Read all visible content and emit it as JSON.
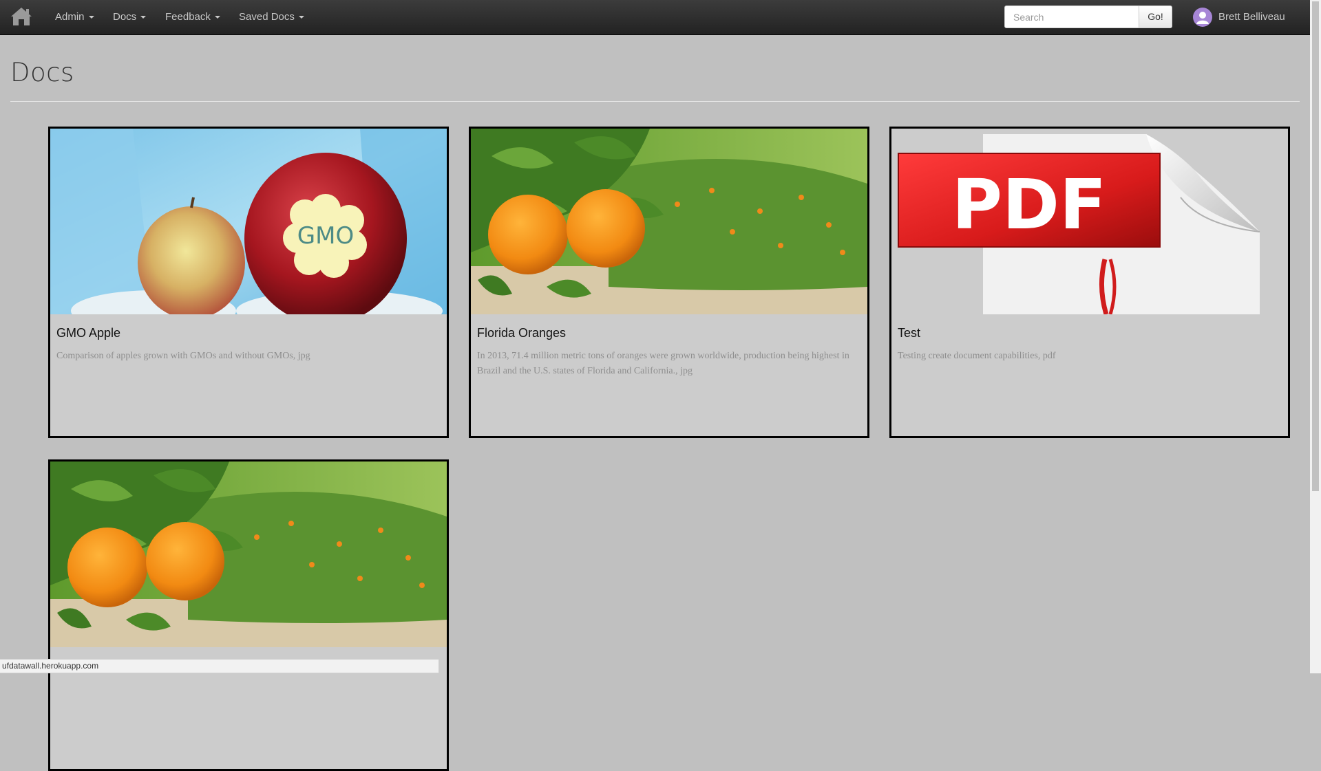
{
  "nav": {
    "home_icon": "home-icon",
    "menus": [
      {
        "label": "Admin"
      },
      {
        "label": "Docs"
      },
      {
        "label": "Feedback"
      },
      {
        "label": "Saved Docs"
      }
    ],
    "search": {
      "placeholder": "Search",
      "value": ""
    },
    "go_label": "Go!",
    "user_name": "Brett Belliveau"
  },
  "page": {
    "title": "Docs"
  },
  "cards": [
    {
      "title": "GMO Apple",
      "description": "Comparison of apples grown with GMOs and without GMOs, jpg",
      "image_alt": "GMO apple photo",
      "image_badge": "GMO"
    },
    {
      "title": "Florida Oranges",
      "description": "In 2013, 71.4 million metric tons of oranges were grown worldwide, production being highest in Brazil and the U.S. states of Florida and California., jpg",
      "image_alt": "Orange tree photo"
    },
    {
      "title": "Test",
      "description": "Testing create document capabilities, pdf",
      "image_alt": "PDF icon",
      "image_badge": "PDF"
    },
    {
      "title": "",
      "description": "",
      "image_alt": "Orange tree photo"
    }
  ],
  "status_bar": {
    "url": "ufdatawall.herokuapp.com"
  },
  "colors": {
    "navbar": "#2b2b2b",
    "page_bg": "#c0c0c0",
    "card_bg": "#cccccc",
    "avatar": "#a786d6"
  }
}
